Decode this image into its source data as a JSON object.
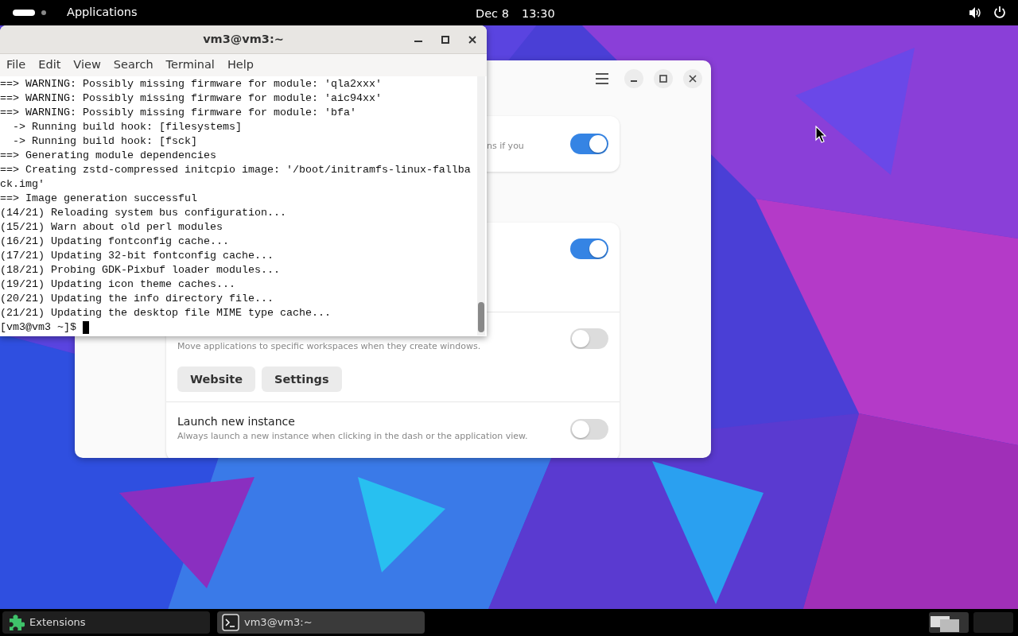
{
  "top_bar": {
    "activities": {
      "workspaces": [
        {
          "selected": true
        },
        {
          "selected": false
        }
      ]
    },
    "menu": "Applications",
    "date": "Dec 8",
    "time": "13:30"
  },
  "extensions_window": {
    "cards": [
      {
        "rows": [
          {
            "subtitle": "ns if you",
            "on": true
          }
        ]
      },
      {
        "rows": [
          {
            "on": true
          },
          {
            "subtitle": "Move applications to specific workspaces when they create windows.",
            "buttons": [
              "Website",
              "Settings"
            ],
            "on": false
          },
          {
            "title": "Launch new instance",
            "subtitle": "Always launch a new instance when clicking in the dash or the application view.",
            "on": false
          }
        ]
      }
    ]
  },
  "terminal": {
    "title": "vm3@vm3:~",
    "menu": [
      "File",
      "Edit",
      "View",
      "Search",
      "Terminal",
      "Help"
    ],
    "lines": [
      "==> WARNING: Possibly missing firmware for module: 'qla2xxx'",
      "==> WARNING: Possibly missing firmware for module: 'aic94xx'",
      "==> WARNING: Possibly missing firmware for module: 'bfa'",
      "  -> Running build hook: [filesystems]",
      "  -> Running build hook: [fsck]",
      "==> Generating module dependencies",
      "==> Creating zstd-compressed initcpio image: '/boot/initramfs-linux-fallba",
      "ck.img'",
      "==> Image generation successful",
      "(14/21) Reloading system bus configuration...",
      "(15/21) Warn about old perl modules",
      "(16/21) Updating fontconfig cache...",
      "(17/21) Updating 32-bit fontconfig cache...",
      "(18/21) Probing GDK-Pixbuf loader modules...",
      "(19/21) Updating icon theme caches...",
      "(20/21) Updating the info directory file...",
      "(21/21) Updating the desktop file MIME type cache..."
    ],
    "prompt": "[vm3@vm3 ~]$"
  },
  "taskbar": {
    "tasks": [
      {
        "kind": "extensions",
        "label": "Extensions",
        "selected": false
      },
      {
        "kind": "terminal",
        "label": "vm3@vm3:~",
        "selected": true
      }
    ],
    "workspaces": [
      {
        "selected": true
      },
      {
        "selected": false
      }
    ]
  }
}
